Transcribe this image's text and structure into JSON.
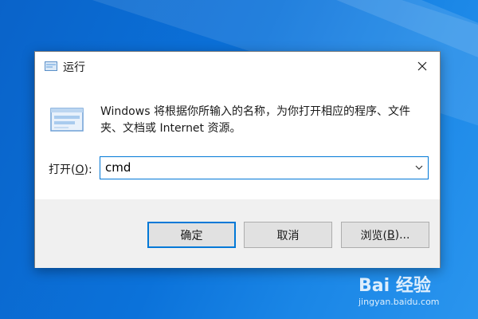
{
  "window": {
    "title": "运行",
    "close_icon": "close-icon",
    "app_icon": "run-icon"
  },
  "content": {
    "description": "Windows 将根据你所输入的名称，为你打开相应的程序、文件夹、文档或 Internet 资源。",
    "open_label_prefix": "打开(",
    "open_label_mnemonic": "O",
    "open_label_suffix": "):",
    "command_value": "cmd"
  },
  "buttons": {
    "ok": "确定",
    "cancel": "取消",
    "browse_prefix": "浏览(",
    "browse_mnemonic": "B",
    "browse_suffix": ")..."
  },
  "watermark": {
    "logo": "Bai 经验",
    "url": "jingyan.baidu.com"
  },
  "colors": {
    "accent": "#0078d7",
    "desktop": "#0b72da",
    "footer": "#f0f0f0"
  }
}
